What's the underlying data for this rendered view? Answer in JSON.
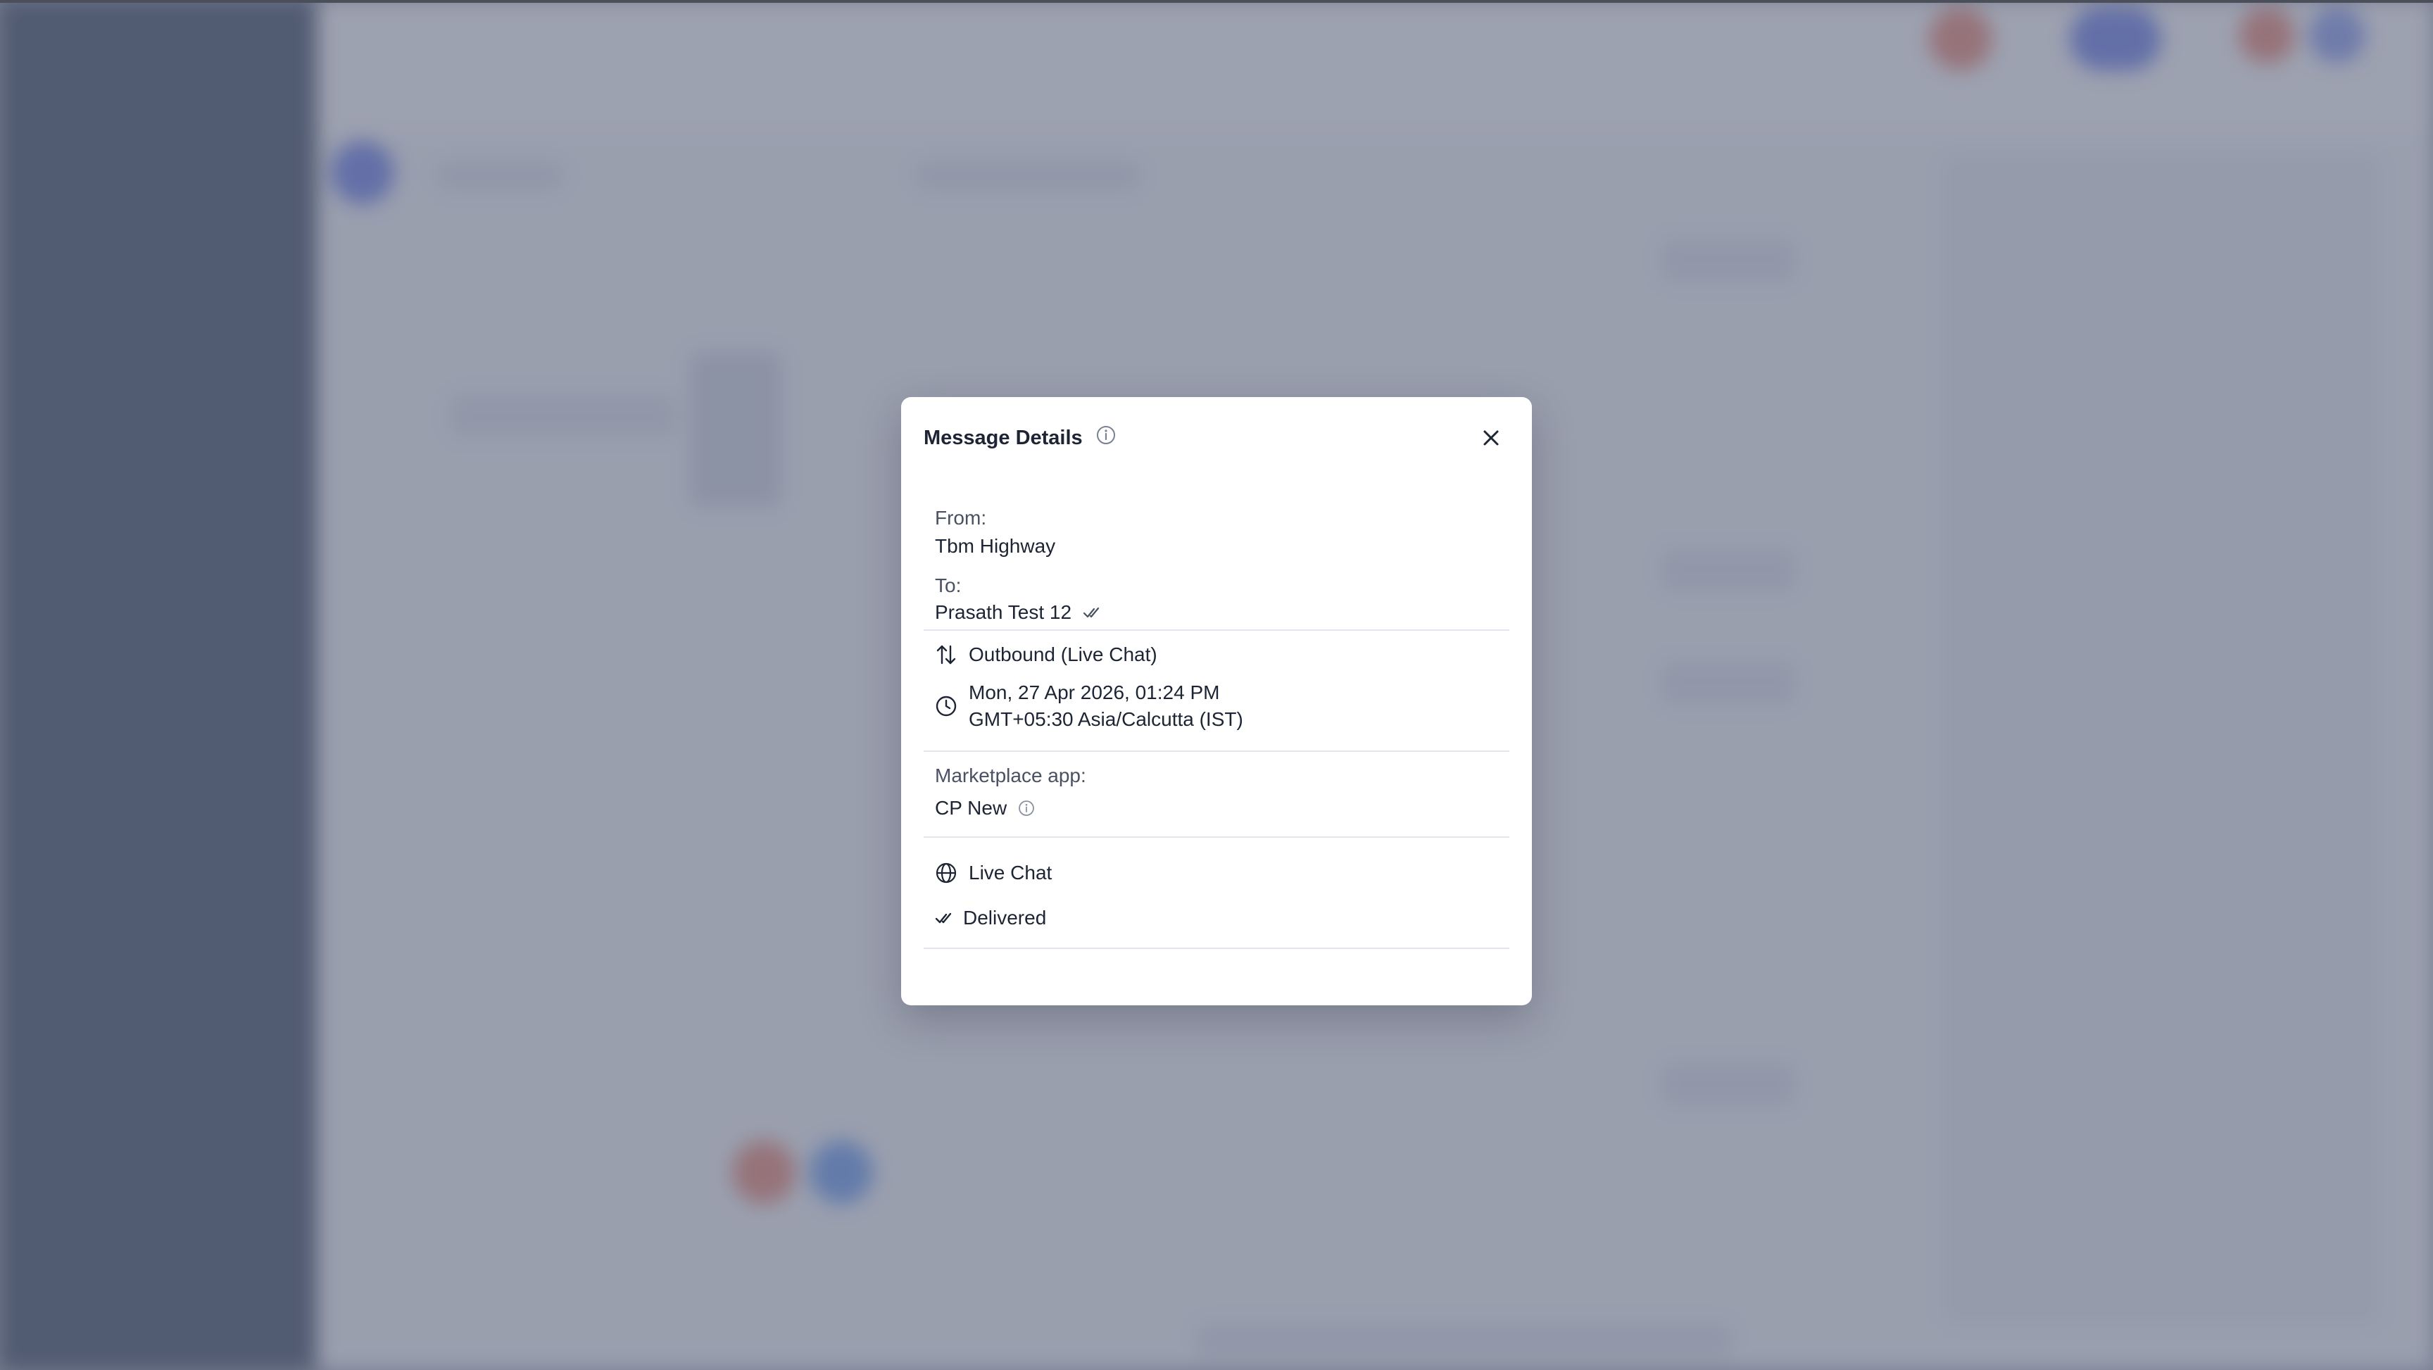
{
  "modal": {
    "title": "Message Details",
    "from_label": "From:",
    "from_value": "Tbm Highway",
    "to_label": "To:",
    "to_value": "Prasath Test 12",
    "direction": "Outbound (Live Chat)",
    "datetime_line1": "Mon, 27 Apr 2026, 01:24 PM",
    "datetime_line2": "GMT+05:30 Asia/Calcutta (IST)",
    "marketplace_label": "Marketplace app:",
    "marketplace_value": "CP New",
    "channel": "Live Chat",
    "status": "Delivered"
  },
  "icons": {
    "title_info": "info-icon",
    "close": "close-icon",
    "to_read": "double-check-icon",
    "direction": "arrows-up-down-icon",
    "time": "clock-icon",
    "marketplace_info": "info-icon",
    "channel": "globe-icon",
    "status": "double-check-icon"
  },
  "colors": {
    "text": "#1d2433",
    "muted": "#4a5163",
    "divider": "#e3e6ec",
    "overlay": "#697084"
  }
}
